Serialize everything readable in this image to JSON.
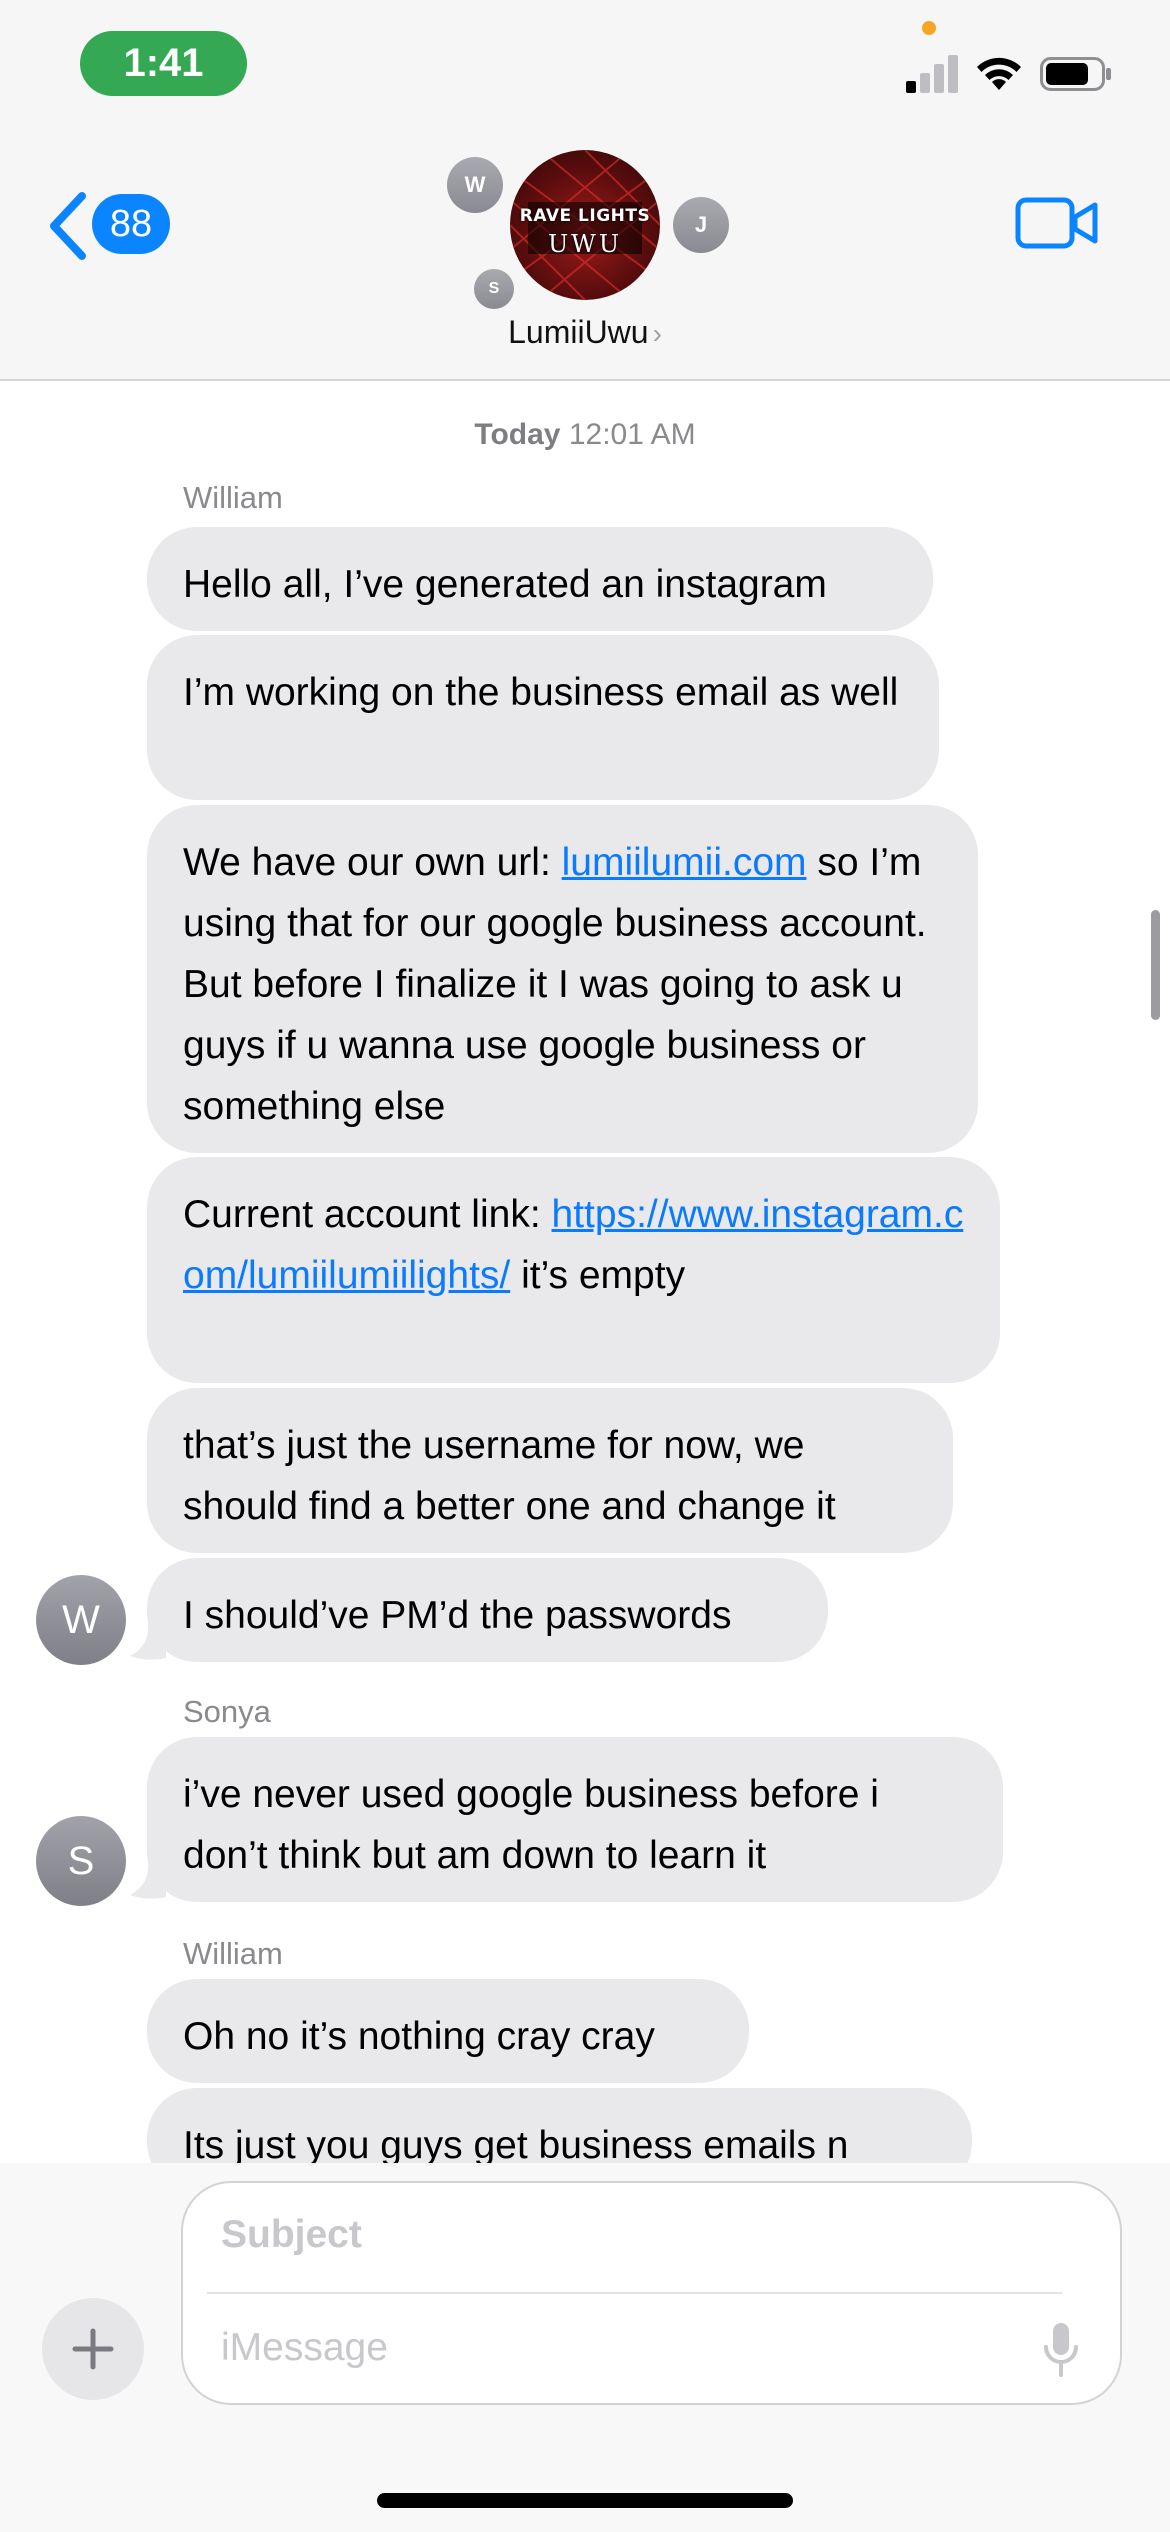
{
  "status_bar": {
    "time": "1:41",
    "cellular_bars_active": 1,
    "battery_level": 0.8,
    "accent_time_color": "#34a853"
  },
  "header": {
    "back_badge_count": "88",
    "contact_name": "LumiiUwu",
    "group_photo_text_line1": "RAVE LIGHTS",
    "group_photo_text_line2": "UWU",
    "participant_initials": [
      "W",
      "J",
      "S"
    ],
    "icons": {
      "back": "chevron-left-icon",
      "video": "video-camera-icon",
      "disclosure": "chevron-right-icon"
    }
  },
  "transcript": {
    "timestamp_day": "Today",
    "timestamp_time": "12:01 AM",
    "groups": [
      {
        "sender": "William",
        "avatar_initial": "W",
        "messages": [
          {
            "text": "Hello all, I’ve generated an instagram"
          },
          {
            "text": "I’m working on the business email as well"
          },
          {
            "before": "We have our own url: ",
            "link": "lumiilumii.com",
            "after": " so I’m using that for our google business account. But before I finalize it I was going to ask u guys if u wanna use google business or something else"
          },
          {
            "before": "Current account link: ",
            "link": "https://www.instagram.com/lumiilumiilights/",
            "after": " it’s empty"
          },
          {
            "text": "that’s just the username for now, we should find a better one and change it"
          },
          {
            "text": "I should’ve PM’d the passwords"
          }
        ]
      },
      {
        "sender": "Sonya",
        "avatar_initial": "S",
        "messages": [
          {
            "text": "i’ve never used google business before i don’t think but am down to learn it"
          }
        ]
      },
      {
        "sender": "William",
        "messages": [
          {
            "text": "Oh no it’s nothing cray cray"
          },
          {
            "text": "Its just you guys get business emails n"
          }
        ]
      }
    ]
  },
  "compose": {
    "subject_placeholder": "Subject",
    "message_placeholder": "iMessage",
    "icons": {
      "add": "plus-icon",
      "dictation": "microphone-icon"
    }
  },
  "colors": {
    "link": "#0a7aff",
    "bubble": "#e9e9eb",
    "badge": "#0a84ff"
  }
}
